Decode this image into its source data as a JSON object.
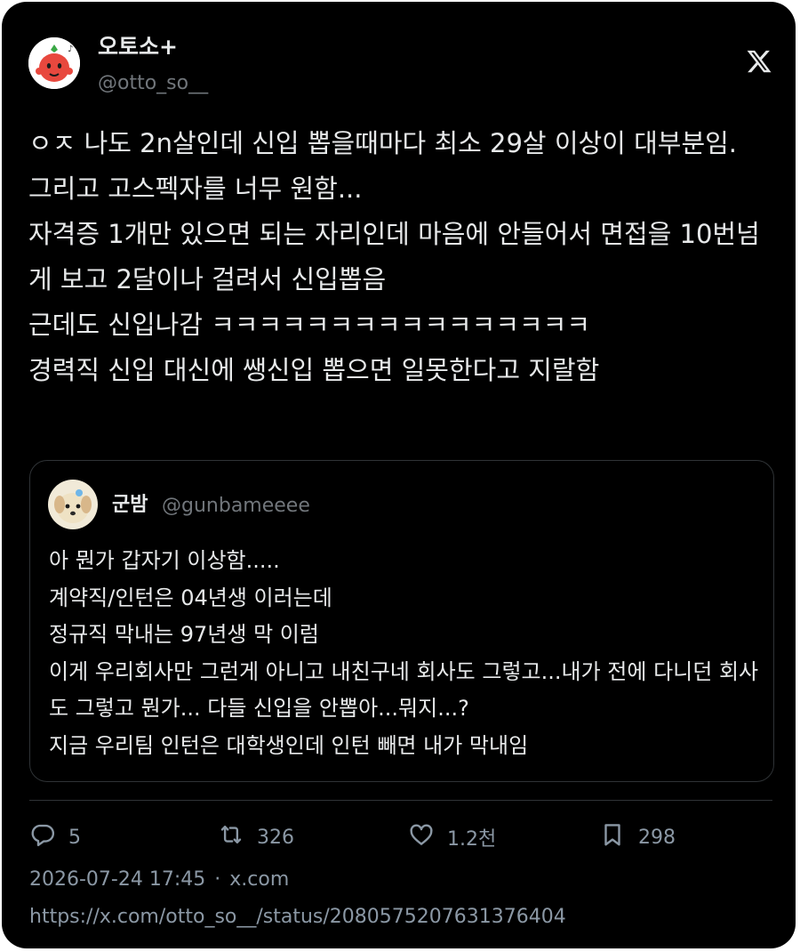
{
  "author": {
    "display_name": "오토소+",
    "handle": "@otto_so__"
  },
  "tweet_text": "ㅇㅈ 나도 2n살인데 신입 뽑을때마다 최소 29살 이상이 대부분임.\n그리고 고스펙자를 너무 원함...\n자격증 1개만 있으면 되는 자리인데 마음에 안들어서 면접을 10번넘게 보고 2달이나 걸려서 신입뽑음\n근데도 신입나감 ㅋㅋㅋㅋㅋㅋㅋㅋㅋㅋㅋㅋㅋㅋㅋㅋ\n경력직 신입 대신에 쌩신입 뽑으면 일못한다고 지랄함",
  "quoted_tweet": {
    "display_name": "군밤",
    "handle": "@gunbameeee",
    "text": "아 뭔가 갑자기 이상함.....\n계약직/인턴은 04년생 이러는데\n정규직 막내는 97년생 막 이럼\n이게 우리회사만 그런게 아니고 내친구네 회사도 그렇고...내가 전에 다니던 회사도 그렇고 뭔가... 다들 신입을 안뽑아...뭐지...?\n지금 우리팀 인턴은 대학생인데 인턴 빼면 내가 막내임"
  },
  "actions": {
    "replies": "5",
    "retweets": "326",
    "likes": "1.2천",
    "bookmarks": "298"
  },
  "meta": {
    "timestamp": "2026-07-24 17:45",
    "separator": "·",
    "source": "x.com",
    "url": "https://x.com/otto_so__/status/2080575207631376404"
  },
  "icons": {
    "platform_logo": "x-logo-icon",
    "reply": "reply-icon",
    "retweet": "retweet-icon",
    "like": "heart-icon",
    "bookmark": "bookmark-icon"
  },
  "colors": {
    "background": "#000000",
    "text_primary": "#e7e9ea",
    "text_secondary": "#71767b",
    "border": "#2f3336"
  }
}
